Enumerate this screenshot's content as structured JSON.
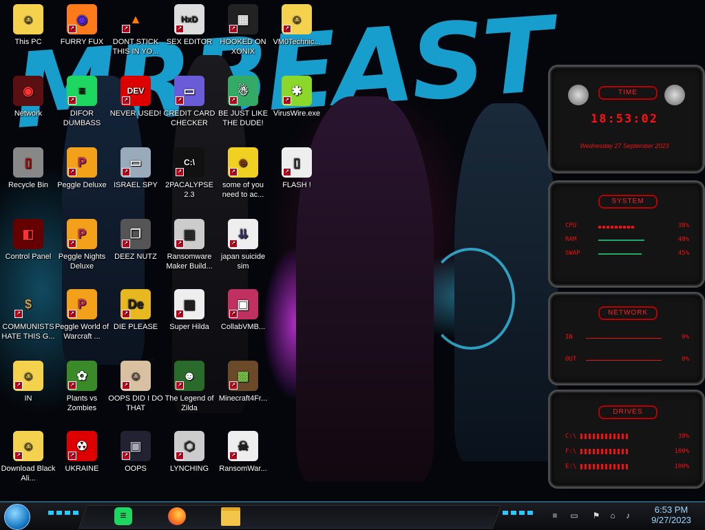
{
  "desktop": {
    "wallpaper_text": "MRBEAST",
    "icons": [
      {
        "label": "This PC",
        "glyph": "☺",
        "bg": "#f4d24e",
        "fg": "#333"
      },
      {
        "label": "FURRY FUX",
        "glyph": "◉",
        "bg": "#ff7a1a",
        "fg": "#5a2ad8"
      },
      {
        "label": "DONT STICK THIS IN YO...",
        "glyph": "▲",
        "bg": "transparent",
        "fg": "#ff7a00"
      },
      {
        "label": "SEX EDITOR",
        "glyph": "HxD",
        "bg": "#ddd",
        "fg": "#222"
      },
      {
        "label": "HOOKED ON XONIX",
        "glyph": "▦",
        "bg": "#222",
        "fg": "#eee"
      },
      {
        "label": "VM0Technic...",
        "glyph": "☺",
        "bg": "#f4d24e",
        "fg": "#333"
      },
      {
        "label": "Network",
        "glyph": "◉",
        "bg": "#5a1010",
        "fg": "#f33"
      },
      {
        "label": "DIFOR DUMBASS",
        "glyph": "≡",
        "bg": "#1ed760",
        "fg": "#000"
      },
      {
        "label": "NEVER USED!",
        "glyph": "DEV",
        "bg": "#d00",
        "fg": "#fff"
      },
      {
        "label": "CREDIT CARD CHECKER",
        "glyph": "▭",
        "bg": "#6a5bd8",
        "fg": "#fff"
      },
      {
        "label": "BE JUST LIKE THE DUDE!",
        "glyph": "☃",
        "bg": "#3a6",
        "fg": "#fff"
      },
      {
        "label": "VirusWire.exe",
        "glyph": "✱",
        "bg": "#8bd82a",
        "fg": "#fff"
      },
      {
        "label": "Recycle Bin",
        "glyph": "▯",
        "bg": "#888",
        "fg": "#c00"
      },
      {
        "label": "Peggle Deluxe",
        "glyph": "P",
        "bg": "#f3a11a",
        "fg": "#c0206a"
      },
      {
        "label": "ISRAEL SPY",
        "glyph": "▭",
        "bg": "#9ab",
        "fg": "#fff"
      },
      {
        "label": "2PACALYPSE 2.3",
        "glyph": "C:\\",
        "bg": "#111",
        "fg": "#fff"
      },
      {
        "label": "some of you need to ac...",
        "glyph": "☻",
        "bg": "#f0d020",
        "fg": "#7a3a10"
      },
      {
        "label": "FLASH !",
        "glyph": "▯",
        "bg": "#eee",
        "fg": "#333"
      },
      {
        "label": "Control Panel",
        "glyph": "◧",
        "bg": "#600",
        "fg": "#f33"
      },
      {
        "label": "Peggle Nights Deluxe",
        "glyph": "P",
        "bg": "#f3a11a",
        "fg": "#c0206a"
      },
      {
        "label": "DEEZ NUTZ",
        "glyph": "❐",
        "bg": "#555",
        "fg": "#ddd"
      },
      {
        "label": "Ransomware Maker Build...",
        "glyph": "▤",
        "bg": "#ccc",
        "fg": "#333"
      },
      {
        "label": "japan suicide sim",
        "glyph": "⇊",
        "bg": "#eee",
        "fg": "#336"
      },
      {
        "label": "COMMUNISTS HATE THIS G...",
        "glyph": "$",
        "bg": "transparent",
        "fg": "#c8a050"
      },
      {
        "label": "Peggle World of Warcraft ...",
        "glyph": "P",
        "bg": "#f3a11a",
        "fg": "#c0206a"
      },
      {
        "label": "DIE PLEASE",
        "glyph": "De",
        "bg": "#e8b820",
        "fg": "#222"
      },
      {
        "label": "Super Hilda",
        "glyph": "▦",
        "bg": "#eee",
        "fg": "#222"
      },
      {
        "label": "CollabVMB...",
        "glyph": "▣",
        "bg": "#c03060",
        "fg": "#fff"
      },
      {
        "label": "IN",
        "glyph": "☺",
        "bg": "#f4d24e",
        "fg": "#333"
      },
      {
        "label": "Plants vs Zombies",
        "glyph": "✿",
        "bg": "#3a8a2a",
        "fg": "#fff"
      },
      {
        "label": "OOPS DID I DO THAT",
        "glyph": "☺",
        "bg": "#d8c0a0",
        "fg": "#333"
      },
      {
        "label": "The Legend of Zilda",
        "glyph": "☻",
        "bg": "#2a6a2a",
        "fg": "#fff"
      },
      {
        "label": "Minecraft4Fr...",
        "glyph": "▩",
        "bg": "#6b4a2a",
        "fg": "#7ac04a"
      },
      {
        "label": "Download Black Ali...",
        "glyph": "☺",
        "bg": "#f4d24e",
        "fg": "#333"
      },
      {
        "label": "UKRAINE",
        "glyph": "☢",
        "bg": "#d00",
        "fg": "#fff"
      },
      {
        "label": "OOPS",
        "glyph": "▣",
        "bg": "#223",
        "fg": "#aab"
      },
      {
        "label": "LYNCHING",
        "glyph": "⬡",
        "bg": "#ccc",
        "fg": "#333"
      },
      {
        "label": "RansomWar...",
        "glyph": "☠",
        "bg": "#eee",
        "fg": "#222"
      }
    ]
  },
  "widgets": {
    "time": {
      "title": "TIME",
      "clock": "18:53:02",
      "date": "Wednesday 27 September 2023"
    },
    "system": {
      "title": "SYSTEM",
      "cpu_label": "CPU",
      "cpu_pct": "38%",
      "ram_label": "RAM",
      "ram_pct": "48%",
      "swap_label": "SWAP",
      "swap_pct": "45%",
      "cpu_val": 0.38,
      "ram_val": 0.48,
      "swap_val": 0.45
    },
    "network": {
      "title": "NETWORK",
      "in_label": "IN",
      "in_pct": "0%",
      "out_label": "OUT",
      "out_pct": "0%"
    },
    "drives": {
      "title": "DRIVES",
      "c_label": "C:\\",
      "c_pct": "38%",
      "f_label": "F:\\",
      "f_pct": "100%",
      "e_label": "E:\\",
      "e_pct": "100%"
    }
  },
  "taskbar": {
    "time": "6:53 PM",
    "date": "9/27/2023",
    "apps": [
      "spotify-icon",
      "firefox-icon",
      "file-explorer-icon"
    ]
  }
}
